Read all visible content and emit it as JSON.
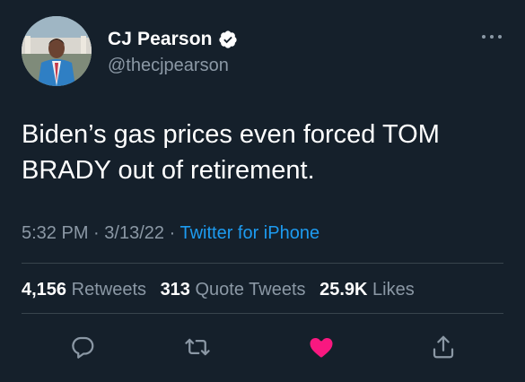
{
  "author": {
    "display_name": "CJ Pearson",
    "handle": "@thecjpearson",
    "verified": true
  },
  "tweet": {
    "text": "Biden’s gas prices even forced TOM BRADY out of retirement.",
    "time": "5:32 PM",
    "date": "3/13/22",
    "separator": "·",
    "source": "Twitter for iPhone"
  },
  "stats": {
    "retweets_count": "4,156",
    "retweets_label": "Retweets",
    "quote_count": "313",
    "quote_label": "Quote Tweets",
    "likes_count": "25.9K",
    "likes_label": "Likes"
  },
  "actions": {
    "reply_icon": "reply-icon",
    "retweet_icon": "retweet-icon",
    "like_icon": "heart-icon",
    "share_icon": "share-icon",
    "liked": true
  },
  "colors": {
    "background": "#15202b",
    "accent": "#1d9bf0",
    "secondary_text": "#8b98a5",
    "like": "#f91880",
    "divider": "#38444d"
  }
}
